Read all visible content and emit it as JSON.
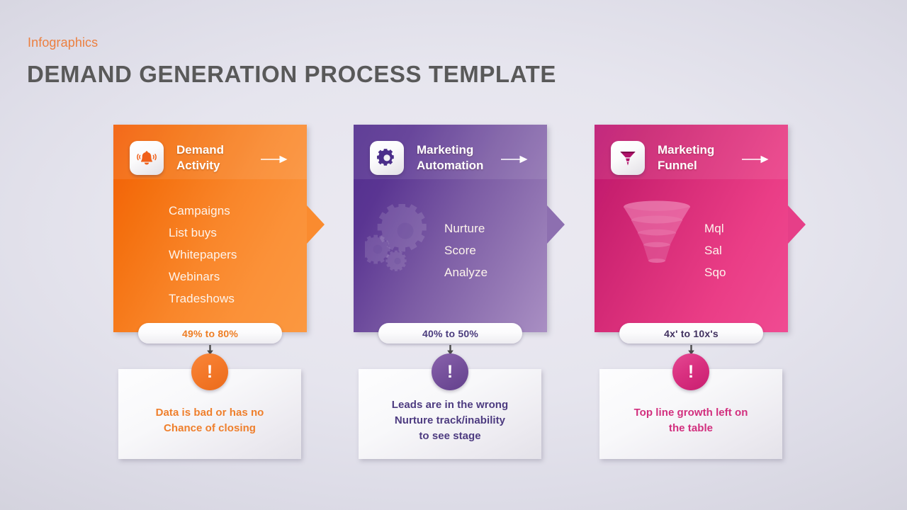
{
  "header": {
    "eyebrow": "Infographics",
    "title": "DEMAND GENERATION PROCESS TEMPLATE"
  },
  "colors": {
    "eyebrow": "#ec7f3f",
    "title": "#595959",
    "background": "#e3e2ec",
    "stage_orange": "#f4700f",
    "stage_purple": "#5a3592",
    "stage_pink": "#c8206f"
  },
  "stages": [
    {
      "id": "demand-activity",
      "title": "Demand\nActivity",
      "title_line1": "Demand",
      "title_line2": "Activity",
      "icon": "bell-icon",
      "arrow_icon": "arrow-right-icon",
      "accent": "#f4700f",
      "items": [
        "Campaigns",
        "List buys",
        "Whitepapers",
        "Webinars",
        "Tradeshows"
      ],
      "metric": "49% to 80%",
      "alert_icon": "exclamation-icon",
      "alert_symbol": "!",
      "note_line1": "Data is bad or has no",
      "note_line2": "Chance of closing",
      "note_line3": "",
      "decoration": ""
    },
    {
      "id": "marketing-automation",
      "title": "Marketing\nAutomation",
      "title_line1": "Marketing",
      "title_line2": "Automation",
      "icon": "gear-icon",
      "arrow_icon": "arrow-right-icon",
      "accent": "#5a3592",
      "items": [
        "Nurture",
        "Score",
        "Analyze"
      ],
      "metric": "40% to 50%",
      "alert_icon": "exclamation-icon",
      "alert_symbol": "!",
      "note_line1": "Leads are in the wrong",
      "note_line2": "Nurture track/inability",
      "note_line3": "to see stage",
      "decoration": "gears-graphic"
    },
    {
      "id": "marketing-funnel",
      "title": "Marketing\nFunnel",
      "title_line1": "Marketing",
      "title_line2": "Funnel",
      "icon": "funnel-icon",
      "arrow_icon": "arrow-right-icon",
      "accent": "#c8206f",
      "items": [
        "Mql",
        "Sal",
        "Sqo"
      ],
      "metric": "4x' to 10x's",
      "alert_icon": "exclamation-icon",
      "alert_symbol": "!",
      "note_line1": "Top line growth left on",
      "note_line2": "the table",
      "note_line3": "",
      "decoration": "funnel-graphic"
    }
  ]
}
